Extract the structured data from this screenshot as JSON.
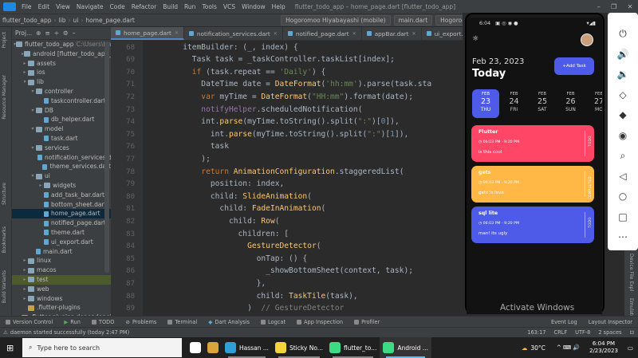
{
  "menubar": {
    "items": [
      "File",
      "Edit",
      "View",
      "Navigate",
      "Code",
      "Refactor",
      "Build",
      "Run",
      "Tools",
      "VCS",
      "Window",
      "Help"
    ],
    "window_title": "flutter_todo_app – home_page.dart [flutter_todo_app]"
  },
  "window_buttons": [
    "–",
    "❐",
    "✕"
  ],
  "navbar": {
    "crumbs": [
      "flutter_todo_app",
      "lib",
      "ui",
      "home_page.dart"
    ],
    "device": "Hogoromoo Hiyabayashi (mobile)",
    "run_config": "main.dart",
    "device2": "Hogoromoo Hiyabayashi"
  },
  "left_strip_labels": [
    "Project",
    "Resource Manager",
    "Structure",
    "Bookmarks",
    "Build Variants"
  ],
  "project": {
    "header": "Proj...",
    "items": [
      {
        "label": "flutter_todo_app",
        "extra": "C:\\Users\\Han",
        "depth": 0,
        "arrow": "▾",
        "icon": "folder"
      },
      {
        "label": "android [flutter_todo_app_a",
        "depth": 1,
        "arrow": "▸",
        "icon": "folder"
      },
      {
        "label": "assets",
        "depth": 1,
        "arrow": "▸",
        "icon": "folder"
      },
      {
        "label": "ios",
        "depth": 1,
        "arrow": "▸",
        "icon": "folder"
      },
      {
        "label": "lib",
        "depth": 1,
        "arrow": "▾",
        "icon": "folder"
      },
      {
        "label": "controller",
        "depth": 2,
        "arrow": "▾",
        "icon": "folder"
      },
      {
        "label": "taskcontroller.dart",
        "depth": 3,
        "arrow": "",
        "icon": "file"
      },
      {
        "label": "DB",
        "depth": 2,
        "arrow": "▾",
        "icon": "folder"
      },
      {
        "label": "db_helper.dart",
        "depth": 3,
        "arrow": "",
        "icon": "file"
      },
      {
        "label": "model",
        "depth": 2,
        "arrow": "▾",
        "icon": "folder"
      },
      {
        "label": "task.dart",
        "depth": 3,
        "arrow": "",
        "icon": "file"
      },
      {
        "label": "services",
        "depth": 2,
        "arrow": "▾",
        "icon": "folder"
      },
      {
        "label": "notification_services.d",
        "depth": 3,
        "arrow": "",
        "icon": "file"
      },
      {
        "label": "theme_services.dart",
        "depth": 3,
        "arrow": "",
        "icon": "file"
      },
      {
        "label": "ui",
        "depth": 2,
        "arrow": "▾",
        "icon": "folder"
      },
      {
        "label": "widgets",
        "depth": 3,
        "arrow": "▸",
        "icon": "folder"
      },
      {
        "label": "add_task_bar.dart",
        "depth": 3,
        "arrow": "",
        "icon": "file"
      },
      {
        "label": "bottom_sheet.dart",
        "depth": 3,
        "arrow": "",
        "icon": "file"
      },
      {
        "label": "home_page.dart",
        "depth": 3,
        "arrow": "",
        "icon": "file",
        "selected": true
      },
      {
        "label": "notified_page.dart",
        "depth": 3,
        "arrow": "",
        "icon": "file"
      },
      {
        "label": "theme.dart",
        "depth": 3,
        "arrow": "",
        "icon": "file"
      },
      {
        "label": "ui_export.dart",
        "depth": 3,
        "arrow": "",
        "icon": "file"
      },
      {
        "label": "main.dart",
        "depth": 2,
        "arrow": "",
        "icon": "file"
      },
      {
        "label": "linux",
        "depth": 1,
        "arrow": "▸",
        "icon": "folder"
      },
      {
        "label": "macos",
        "depth": 1,
        "arrow": "▸",
        "icon": "folder"
      },
      {
        "label": "test",
        "depth": 1,
        "arrow": "▸",
        "icon": "folder",
        "test": true
      },
      {
        "label": "web",
        "depth": 1,
        "arrow": "▸",
        "icon": "folder"
      },
      {
        "label": "windows",
        "depth": 1,
        "arrow": "▸",
        "icon": "folder"
      },
      {
        "label": ".flutter-plugins",
        "depth": 1,
        "arrow": "",
        "icon": "mod"
      },
      {
        "label": ".flutter-plugins-dependencies",
        "depth": 1,
        "arrow": "",
        "icon": "mod"
      }
    ]
  },
  "tabs": [
    {
      "label": "home_page.dart",
      "active": true
    },
    {
      "label": "notification_services.dart"
    },
    {
      "label": "notified_page.dart"
    },
    {
      "label": "appBar.dart"
    },
    {
      "label": "ui_export.dart"
    },
    {
      "label": "the"
    }
  ],
  "editor": {
    "lines": [
      {
        "n": "68",
        "tokens": [
          [
            "",
            "        itemBuilder: (_, index) {"
          ]
        ]
      },
      {
        "n": "69",
        "tokens": [
          [
            "",
            "          Task task = _taskController.taskList[index];"
          ]
        ]
      },
      {
        "n": "70",
        "tokens": [
          [
            "kw",
            "          if "
          ],
          [
            "",
            "(task.repeat == "
          ],
          [
            "st",
            "'Daily'"
          ],
          [
            "",
            ") {"
          ]
        ]
      },
      {
        "n": "71",
        "tokens": [
          [
            "",
            "            DateTime date = "
          ],
          [
            "fn",
            "DateFormat"
          ],
          [
            "",
            "("
          ],
          [
            "st",
            "'hh:mm'"
          ],
          [
            "",
            ").parse(task.sta"
          ]
        ]
      },
      {
        "n": "72",
        "tokens": [
          [
            "kw",
            "            var "
          ],
          [
            "",
            "myTime = "
          ],
          [
            "fn",
            "DateFormat"
          ],
          [
            "",
            "("
          ],
          [
            "st",
            "\"HH:mm\""
          ],
          [
            "",
            ").format(date);"
          ]
        ]
      },
      {
        "n": "73",
        "tokens": [
          [
            "pr",
            "            notifyHelper"
          ],
          [
            "",
            ".scheduledNotification("
          ]
        ]
      },
      {
        "n": "74",
        "tokens": [
          [
            "",
            "            int."
          ],
          [
            "fn",
            "parse"
          ],
          [
            "",
            "(myTime.toString().split("
          ],
          [
            "st",
            "\":\""
          ],
          [
            "",
            ")["
          ],
          [
            "nm",
            "0"
          ],
          [
            "",
            "]),"
          ]
        ]
      },
      {
        "n": "75",
        "tokens": [
          [
            "",
            "              int."
          ],
          [
            "fn",
            "parse"
          ],
          [
            "",
            "(myTime.toString().split("
          ],
          [
            "st",
            "\":\""
          ],
          [
            "",
            ")["
          ],
          [
            "nm",
            "1"
          ],
          [
            "",
            "]),"
          ]
        ]
      },
      {
        "n": "76",
        "tokens": [
          [
            "",
            "              task"
          ]
        ]
      },
      {
        "n": "77",
        "tokens": [
          [
            "",
            "            );"
          ]
        ]
      },
      {
        "n": "78",
        "tokens": [
          [
            "kw",
            "            return "
          ],
          [
            "fn",
            "AnimationConfiguration"
          ],
          [
            "",
            ".staggeredList("
          ]
        ]
      },
      {
        "n": "79",
        "tokens": [
          [
            "",
            "              position: index,"
          ]
        ]
      },
      {
        "n": "80",
        "tokens": [
          [
            "",
            "              child: "
          ],
          [
            "fn",
            "SlideAnimation"
          ],
          [
            "",
            "("
          ]
        ]
      },
      {
        "n": "81",
        "tokens": [
          [
            "",
            "                child: "
          ],
          [
            "fn",
            "FadeInAnimation"
          ],
          [
            "",
            "("
          ]
        ]
      },
      {
        "n": "82",
        "tokens": [
          [
            "",
            "                  child: "
          ],
          [
            "fn",
            "Row"
          ],
          [
            "",
            "("
          ]
        ]
      },
      {
        "n": "83",
        "tokens": [
          [
            "",
            "                    children: ["
          ]
        ]
      },
      {
        "n": "84",
        "tokens": [
          [
            "",
            "                      "
          ],
          [
            "fn",
            "GestureDetector"
          ],
          [
            "",
            "("
          ]
        ]
      },
      {
        "n": "85",
        "tokens": [
          [
            "",
            "                        onTap: () {"
          ]
        ]
      },
      {
        "n": "86",
        "tokens": [
          [
            "",
            "                          _showBottomSheet(context, task);"
          ]
        ]
      },
      {
        "n": "87",
        "tokens": [
          [
            "",
            "                        },"
          ]
        ]
      },
      {
        "n": "88",
        "tokens": [
          [
            "",
            "                        child: "
          ],
          [
            "fn",
            "TaskTile"
          ],
          [
            "",
            "(task),"
          ]
        ]
      },
      {
        "n": "89",
        "tokens": [
          [
            "",
            "                      )  "
          ],
          [
            "cm",
            "// GestureDetector"
          ]
        ]
      }
    ]
  },
  "phone": {
    "time": "6:04",
    "date": "Feb 23, 2023",
    "today": "Today",
    "add_task": "+Add Task",
    "dates": [
      {
        "m": "FEB",
        "d": "23",
        "w": "THU",
        "sel": true
      },
      {
        "m": "FEB",
        "d": "24",
        "w": "FRI"
      },
      {
        "m": "FEB",
        "d": "25",
        "w": "SAT"
      },
      {
        "m": "FEB",
        "d": "26",
        "w": "SUN"
      },
      {
        "m": "FEB",
        "d": "27",
        "w": "MO"
      }
    ],
    "cards": [
      {
        "title": "Flutter",
        "time": "06:03 PM - 9:20 PM",
        "note": "is this cool",
        "status": "TODO",
        "color": "#ff4667"
      },
      {
        "title": "gets",
        "time": "06:03 PM - 9:20 PM",
        "note": "getx is love",
        "status": "COMPLETED",
        "color": "#ffb746"
      },
      {
        "title": "sql lite",
        "time": "06:03 PM - 9:20 PM",
        "note": "man! its ugly",
        "status": "TODO",
        "color": "#4e5ae8"
      }
    ]
  },
  "emulator_buttons": [
    "power-icon",
    "volume-up-icon",
    "volume-down-icon",
    "rotate-left-icon",
    "rotate-right-icon",
    "camera-icon",
    "zoom-icon",
    "back-icon",
    "home-icon",
    "overview-icon",
    "more-icon"
  ],
  "emulator_glyphs": [
    "⏻",
    "🔊",
    "🔉",
    "◇",
    "◆",
    "◉",
    "⌕",
    "◁",
    "○",
    "□",
    "⋯"
  ],
  "right_strip_labels": [
    "Device File Expl",
    "Emulator"
  ],
  "watermark": {
    "line1": "Activate Windows",
    "line2": "Go to Settings to activate Windows."
  },
  "toolbar": {
    "items": [
      "Version Control",
      "Run",
      "TODO",
      "Problems",
      "Terminal",
      "Dart Analysis",
      "Logcat",
      "App Inspection",
      "Profiler"
    ],
    "right_items": [
      "Event Log",
      "Layout Inspector"
    ]
  },
  "statusline": {
    "message": "daemon started successfully (today 2:47 PM)",
    "position": "163:17",
    "eol": "CRLF",
    "encoding": "UTF-8",
    "indent": "2 spaces"
  },
  "taskbar": {
    "search_placeholder": "Type here to search",
    "apps": [
      {
        "label": "",
        "color": "#ffffff"
      },
      {
        "label": "",
        "color": "#d9a43a"
      },
      {
        "label": "Hassan ...",
        "color": "#2ea0d6"
      },
      {
        "label": "Sticky No...",
        "color": "#f5d33a"
      },
      {
        "label": "flutter_to...",
        "color": "#3ddc84"
      },
      {
        "label": "Android ...",
        "color": "#3ddc84"
      }
    ],
    "weather": "30°C",
    "tray": "^  ⌨  🔊",
    "clock_time": "6:04 PM",
    "clock_date": "2/23/2023"
  }
}
